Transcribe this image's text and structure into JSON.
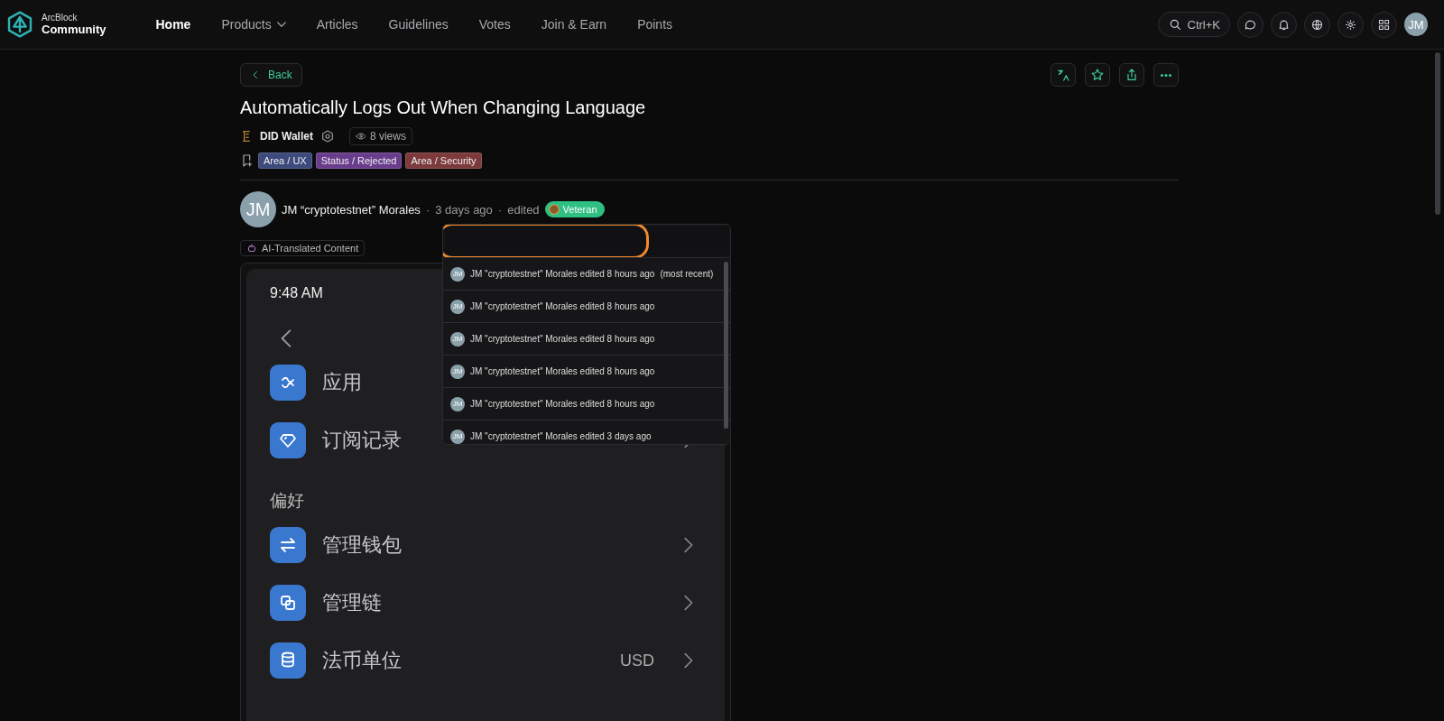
{
  "header": {
    "logo_top": "ArcBlock",
    "logo_bottom": "Community",
    "nav": [
      {
        "label": "Home",
        "selected": true,
        "has_menu": false
      },
      {
        "label": "Products",
        "selected": false,
        "has_menu": true
      },
      {
        "label": "Articles",
        "selected": false,
        "has_menu": false
      },
      {
        "label": "Guidelines",
        "selected": false,
        "has_menu": false
      },
      {
        "label": "Votes",
        "selected": false,
        "has_menu": false
      },
      {
        "label": "Join & Earn",
        "selected": false,
        "has_menu": false
      },
      {
        "label": "Points",
        "selected": false,
        "has_menu": false
      }
    ],
    "search_shortcut": "Ctrl+K",
    "avatar": "JM"
  },
  "post": {
    "back": "Back",
    "title": "Automatically Logs Out When Changing Language",
    "product": "DID Wallet",
    "views": "8 views",
    "tags": [
      {
        "label": "Area / UX",
        "color": "#3c4a7c"
      },
      {
        "label": "Status / Rejected",
        "color": "#6a3d8c"
      },
      {
        "label": "Area / Security",
        "color": "#7c3a3c"
      }
    ],
    "author": {
      "avatar": "JM",
      "name": "JM “cryptotestnet” Morales",
      "separator": "·",
      "time": "3 days ago",
      "dot": "·",
      "edited": "edited",
      "badge": "Veteran"
    },
    "translated_badge": "AI-Translated Content",
    "screenshot": {
      "time": "9:48 AM",
      "rows": [
        {
          "kind": "item",
          "label": "应用"
        },
        {
          "kind": "item",
          "label": "订阅记录"
        },
        {
          "kind": "section",
          "label": "偏好"
        },
        {
          "kind": "item",
          "label": "管理钱包"
        },
        {
          "kind": "item",
          "label": "管理链"
        },
        {
          "kind": "item",
          "label": "法币单位",
          "value": "USD"
        }
      ]
    }
  },
  "history_menu": {
    "items": [
      {
        "avatar": "JM",
        "text": "JM \"cryptotestnet\" Morales edited 8 hours ago",
        "note": "(most recent)"
      },
      {
        "avatar": "JM",
        "text": "JM \"cryptotestnet\" Morales edited 8 hours ago"
      },
      {
        "avatar": "JM",
        "text": "JM \"cryptotestnet\" Morales edited 8 hours ago"
      },
      {
        "avatar": "JM",
        "text": "JM \"cryptotestnet\" Morales edited 8 hours ago"
      },
      {
        "avatar": "JM",
        "text": "JM \"cryptotestnet\" Morales edited 8 hours ago"
      },
      {
        "avatar": "JM",
        "text": "JM \"cryptotestnet\" Morales edited 3 days ago"
      }
    ]
  }
}
